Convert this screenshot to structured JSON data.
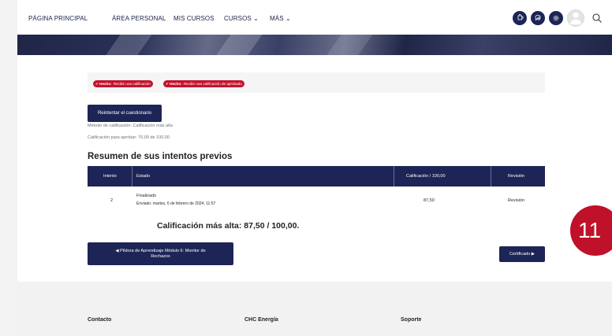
{
  "nav": {
    "items": [
      "PÁGINA PRINCIPAL",
      "ÁREA PERSONAL",
      "MIS CURSOS",
      "CURSOS",
      "MÁS"
    ],
    "icons": [
      "puzzle-icon",
      "chat-icon",
      "gear-icon",
      "avatar",
      "search-icon"
    ]
  },
  "completion": {
    "items": [
      {
        "prefix": "✔ Hecho:",
        "text": "Recibir una calificación"
      },
      {
        "prefix": "✔ Hecho:",
        "text": "Recibir una calificación de aprobado"
      }
    ]
  },
  "quiz": {
    "reattempt_label": "Reintentar el cuestionario",
    "grading_method": "Método de calificación: Calificación más alta",
    "pass_grade": "Calificación para aprobar: 70,00 de 100,00"
  },
  "summary": {
    "title": "Resumen de sus intentos previos",
    "headers": [
      "Intento",
      "Estado",
      "Calificación / 100,00",
      "Revisión"
    ],
    "rows": [
      {
        "attempt": "2",
        "state": "Finalizado",
        "submitted": "Enviado: martes, 6 de febrero de 2024, 11:57",
        "grade": "87,50",
        "review": "Revisión"
      }
    ]
  },
  "best_grade": "Calificación más alta: 87,50 / 100,00.",
  "navigation": {
    "prev_label_line1": "◀ Píldora de Aprendizaje Módulo 6: Monitor de",
    "prev_label_line2": "Rechazos",
    "next_label": "Certificado ▶"
  },
  "badge": "11",
  "footer": {
    "columns": [
      "Contacto",
      "CHC Energía",
      "Soporte"
    ]
  },
  "colors": {
    "primary": "#1d2456",
    "accent_red": "#c4122f"
  }
}
